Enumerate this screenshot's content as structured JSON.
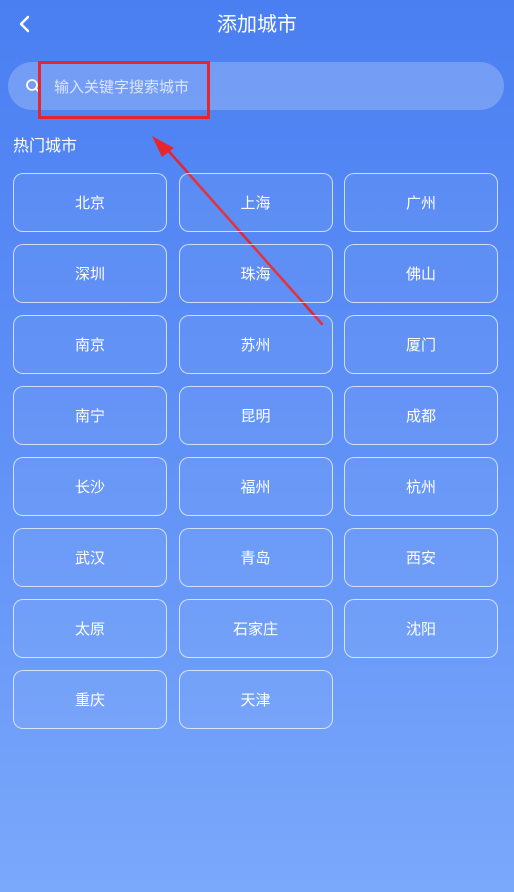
{
  "header": {
    "title": "添加城市",
    "back_icon": "chevron-left-icon"
  },
  "search": {
    "placeholder": "输入关键字搜索城市",
    "value": "",
    "icon": "search-icon"
  },
  "hot_cities": {
    "title": "热门城市",
    "items": [
      "北京",
      "上海",
      "广州",
      "深圳",
      "珠海",
      "佛山",
      "南京",
      "苏州",
      "厦门",
      "南宁",
      "昆明",
      "成都",
      "长沙",
      "福州",
      "杭州",
      "武汉",
      "青岛",
      "西安",
      "太原",
      "石家庄",
      "沈阳",
      "重庆",
      "天津"
    ]
  },
  "annotation": {
    "box_color": "#e5262f",
    "arrow_color": "#e5262f"
  }
}
